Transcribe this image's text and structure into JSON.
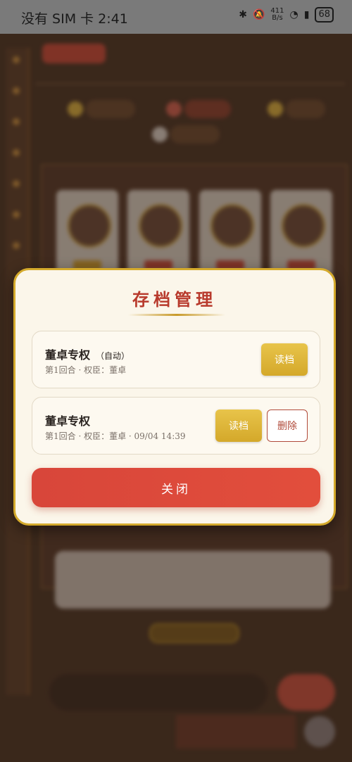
{
  "status_bar": {
    "carrier_time": "没有 SIM 卡 2:41",
    "net_speed_top": "411",
    "net_speed_bottom": "B/s",
    "battery": "68",
    "icons": [
      "bluetooth-icon",
      "mute-icon",
      "wifi-icon",
      "battery-saver-icon",
      "battery-icon"
    ]
  },
  "modal": {
    "title": "存档管理",
    "saves": [
      {
        "name": "董卓专权",
        "tag": "（自动）",
        "meta": "第1回合 · 权臣：董卓",
        "load_label": "读档"
      },
      {
        "name": "董卓专权",
        "meta": "第1回合 · 权臣：董卓 · 09/04 14:39",
        "load_label": "读档",
        "delete_label": "删除"
      }
    ],
    "close_label": "关闭"
  },
  "colors": {
    "accent_gold": "#d4aa2c",
    "title_red": "#b83a2c",
    "close_red": "#e04a3c"
  }
}
